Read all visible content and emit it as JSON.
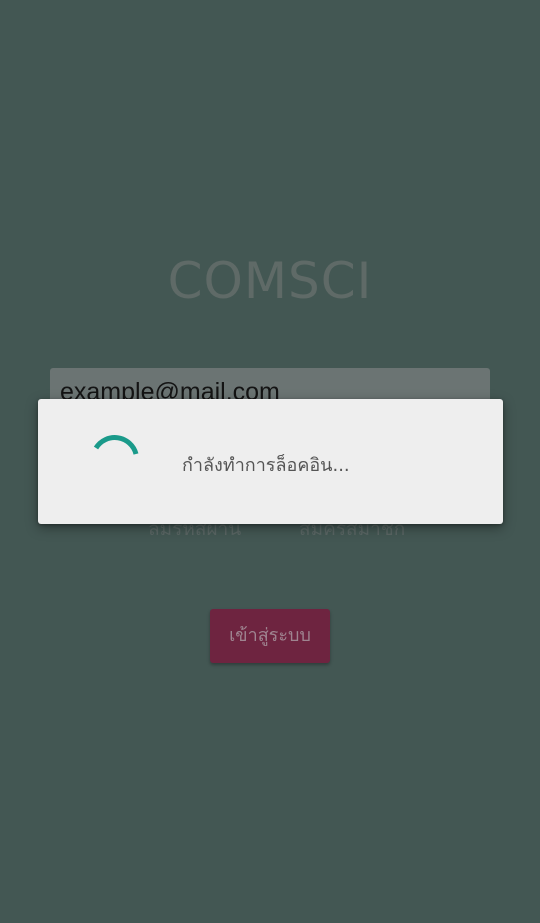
{
  "app": {
    "logo_text": "COMSCI"
  },
  "login_form": {
    "email_value": "example@mail.com",
    "forgot_password_label": "ลืมรหัสผ่าน",
    "register_label": "สมัครสมาชิก",
    "login_button_label": "เข้าสู่ระบบ"
  },
  "progress_dialog": {
    "message": "กำลังทำการล็อคอิน...",
    "spinner_icon": "circular-progress-icon",
    "spinner_color": "#1a9a8a"
  },
  "colors": {
    "background": "#435753",
    "login_button": "#6e2440",
    "dialog_background": "#eeeeee"
  }
}
